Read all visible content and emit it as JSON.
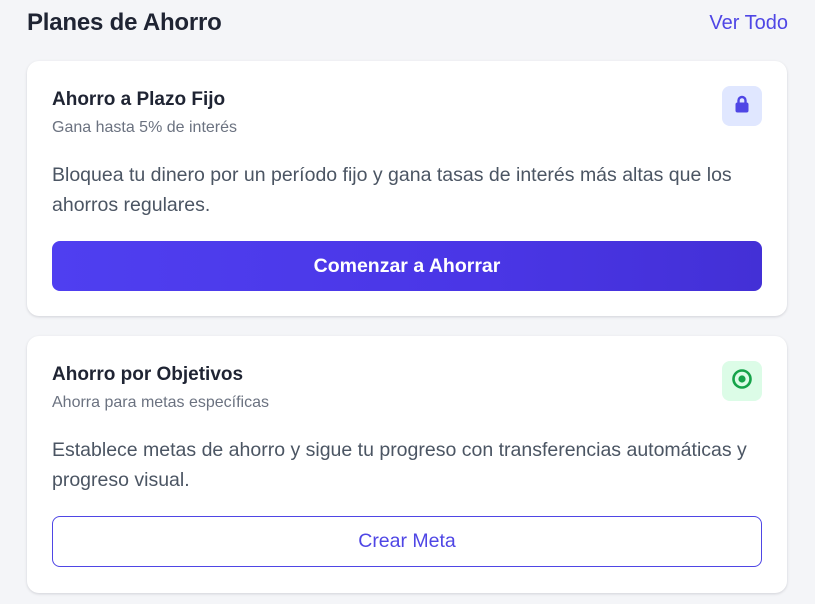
{
  "header": {
    "title": "Planes de Ahorro",
    "view_all_label": "Ver Todo"
  },
  "plans": [
    {
      "title": "Ahorro a Plazo Fijo",
      "subtitle": "Gana hasta 5% de interés",
      "description": "Bloquea tu dinero por un período fijo y gana tasas de interés más altas que los ahorros regulares.",
      "button_label": "Comenzar a Ahorrar",
      "icon": "lock-icon",
      "icon_color": "#4f46e5",
      "badge_color": "#e0e7ff"
    },
    {
      "title": "Ahorro por Objetivos",
      "subtitle": "Ahorra para metas específicas",
      "description": "Establece metas de ahorro y sigue tu progreso con transferencias automáticas y progreso visual.",
      "button_label": "Crear Meta",
      "icon": "target-icon",
      "icon_color": "#16a34a",
      "badge_color": "#dcfce7"
    }
  ],
  "colors": {
    "accent": "#4f46e5",
    "background": "#f4f5f8",
    "card": "#ffffff"
  }
}
